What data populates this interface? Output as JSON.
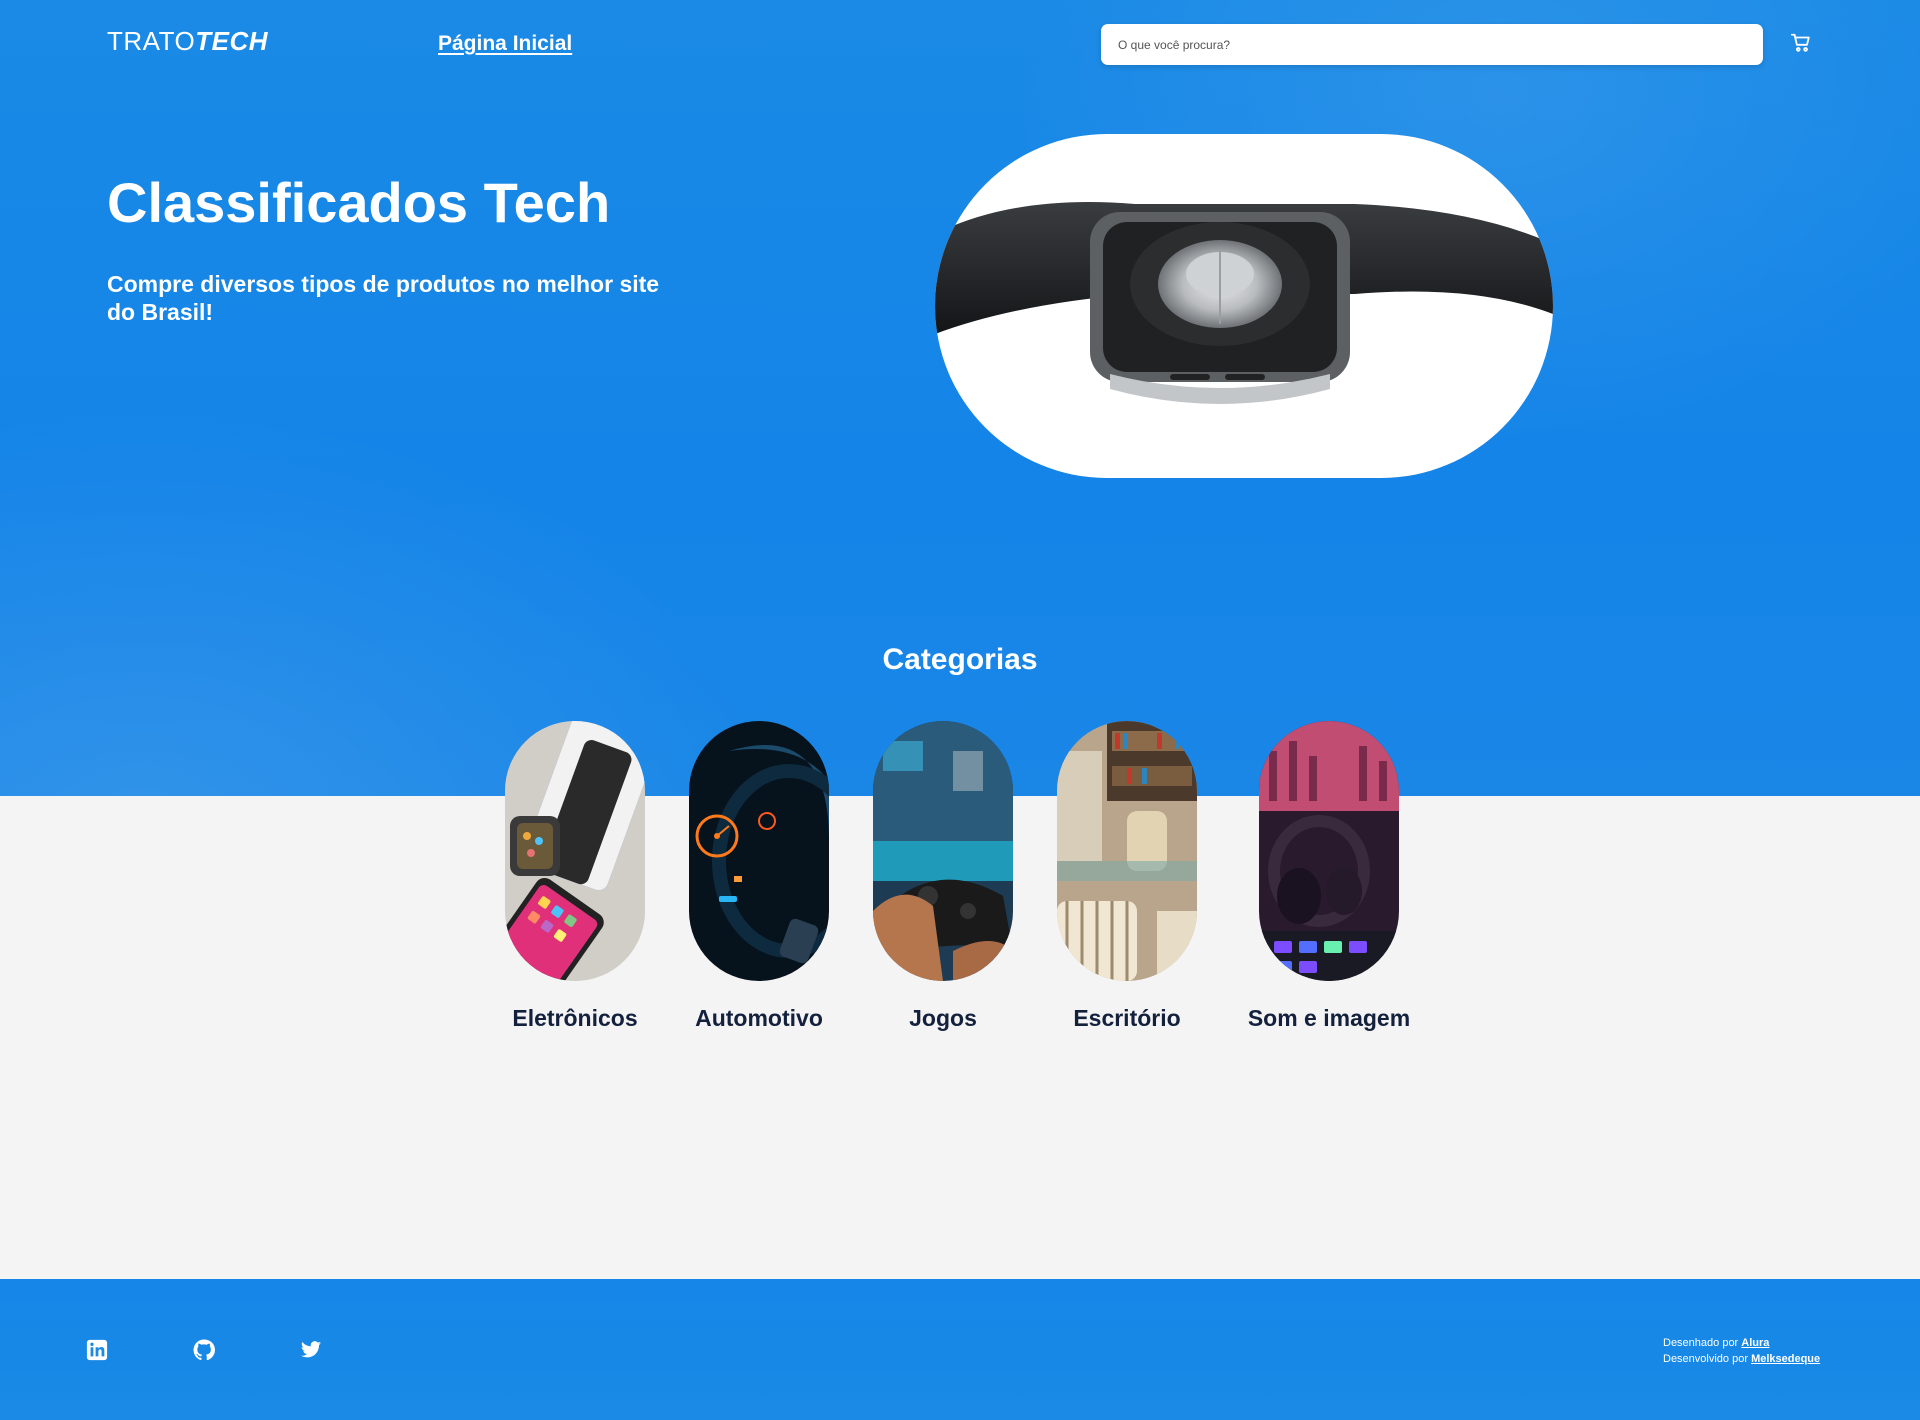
{
  "header": {
    "logo_light": "TRATO",
    "logo_bold": "TECH",
    "nav_home": "Página Inicial",
    "search_placeholder": "O que você procura?",
    "cart_icon": "cart-icon"
  },
  "hero": {
    "title": "Classificados Tech",
    "subtitle": "Compre diversos tipos de produtos no melhor site do Brasil!",
    "image": "smartwatch-photo"
  },
  "categories": {
    "title": "Categorias",
    "items": [
      {
        "label": "Eletrônicos",
        "image": "electronics-photo"
      },
      {
        "label": "Automotivo",
        "image": "car-dashboard-photo"
      },
      {
        "label": "Jogos",
        "image": "gamepad-photo"
      },
      {
        "label": "Escritório",
        "image": "office-photo"
      },
      {
        "label": "Som e imagem",
        "image": "headphones-photo"
      }
    ]
  },
  "footer": {
    "socials": [
      "linkedin-icon",
      "github-icon",
      "twitter-icon"
    ],
    "designed_prefix": "Desenhado por",
    "designed_by": "Alura",
    "developed_prefix": "Desenvolvido por",
    "developed_by": "Melksedeque"
  },
  "colors": {
    "primary_blue": "#1a8ae6",
    "background": "#f4f4f5",
    "dark_text": "#14213d",
    "white": "#ffffff"
  }
}
